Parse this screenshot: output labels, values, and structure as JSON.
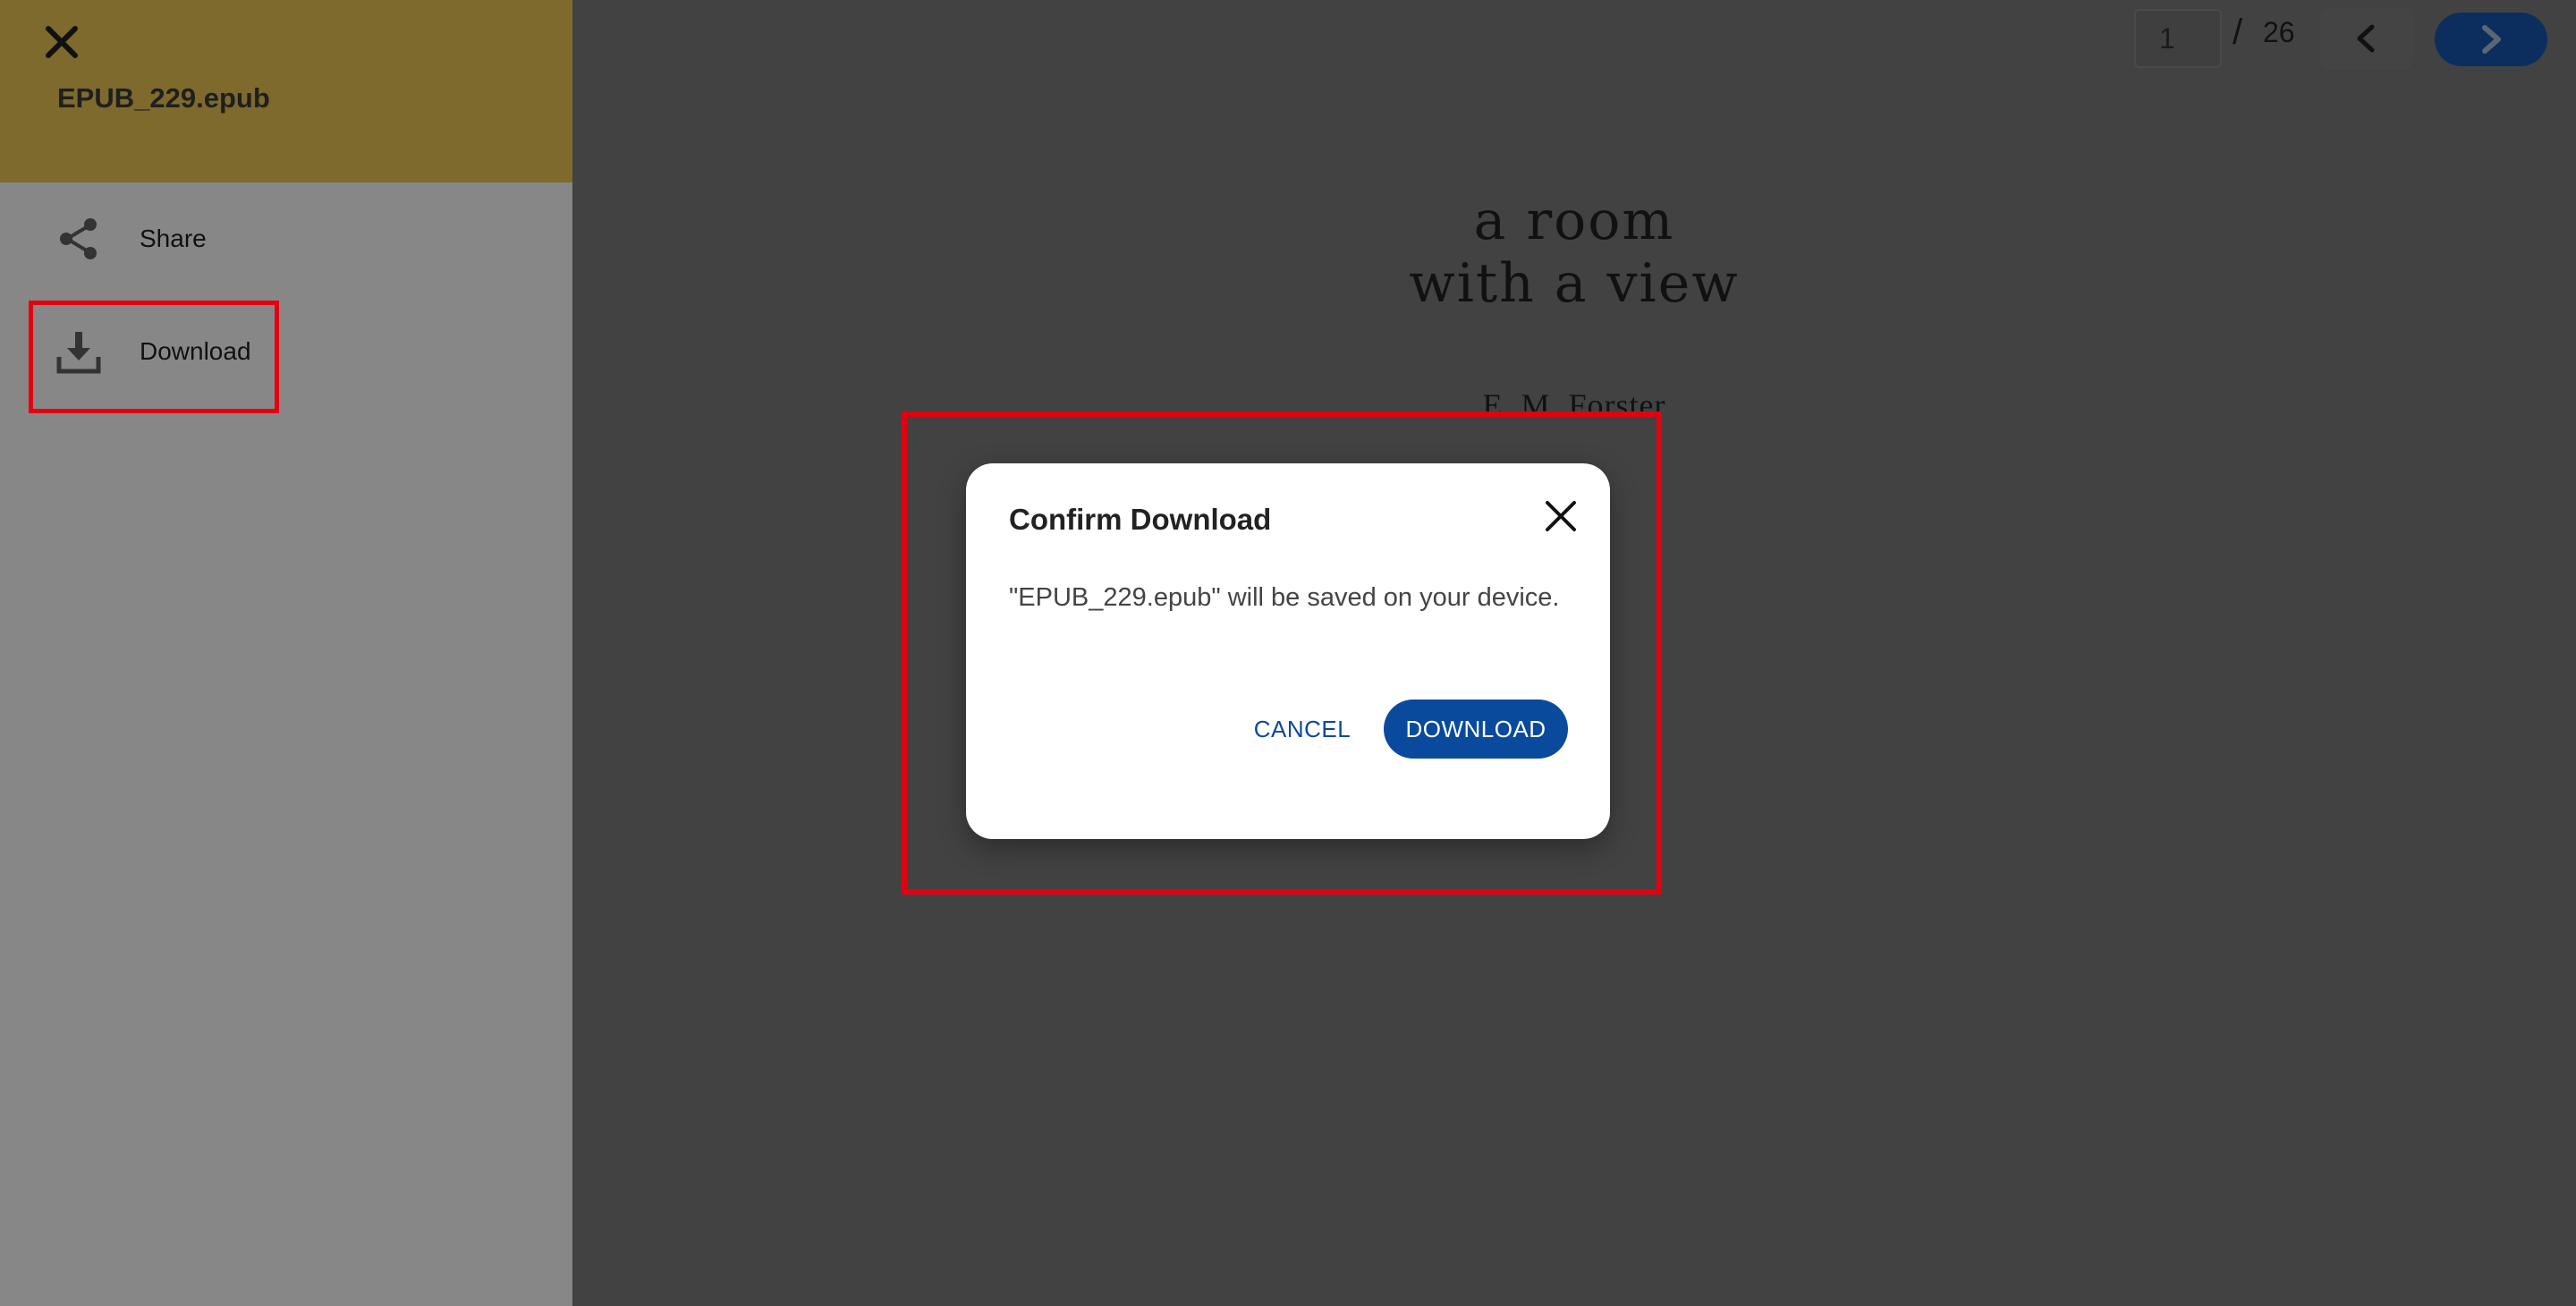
{
  "reader": {
    "book_title_line1": "a room",
    "book_title_line2": "with a view",
    "book_author": "E. M. Forster",
    "toolbar": {
      "current_page": "1",
      "separator": "/",
      "total_pages": "26",
      "prev_icon": "chevron-left-icon",
      "next_icon": "chevron-right-icon"
    }
  },
  "drawer": {
    "close_icon": "close-icon",
    "filename": "EPUB_229.epub",
    "items": [
      {
        "label": "Share",
        "icon": "share-icon"
      },
      {
        "label": "Download",
        "icon": "download-icon"
      }
    ]
  },
  "modal": {
    "title": "Confirm Download",
    "message": "\"EPUB_229.epub\" will be saved on your device.",
    "cancel_label": "CANCEL",
    "download_label": "DOWNLOAD",
    "close_icon": "close-icon"
  },
  "colors": {
    "drawer_header": "#7d6a2c",
    "primary_button": "#094a9c",
    "highlight": "#e3000f",
    "overlay": "#424242"
  }
}
